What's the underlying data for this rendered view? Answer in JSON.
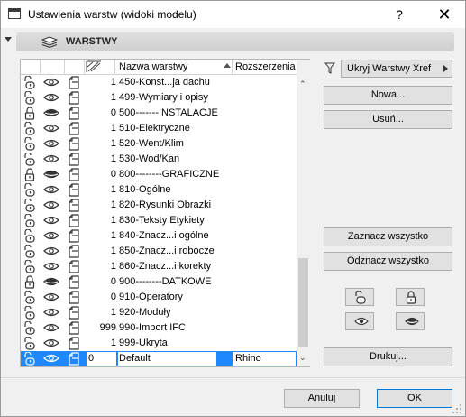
{
  "window": {
    "title": "Ustawienia warstw (widoki modelu)",
    "help_label": "?",
    "close_label": "✕"
  },
  "section": {
    "title": "WARSTWY"
  },
  "table": {
    "headers": {
      "name": "Nazwa warstwy",
      "extension": "Rozszerzenia"
    },
    "rows": [
      {
        "lock": "unlocked",
        "visible": true,
        "pen": "1",
        "name": "450-Konst...ja dachu",
        "ext": ""
      },
      {
        "lock": "unlocked",
        "visible": true,
        "pen": "1",
        "name": "499-Wymiary i opisy",
        "ext": ""
      },
      {
        "lock": "locked",
        "visible": false,
        "pen": "0",
        "name": "500-------INSTALACJE",
        "ext": ""
      },
      {
        "lock": "unlocked",
        "visible": true,
        "pen": "1",
        "name": "510-Elektryczne",
        "ext": ""
      },
      {
        "lock": "unlocked",
        "visible": true,
        "pen": "1",
        "name": "520-Went/Klim",
        "ext": ""
      },
      {
        "lock": "unlocked",
        "visible": true,
        "pen": "1",
        "name": "530-Wod/Kan",
        "ext": ""
      },
      {
        "lock": "locked",
        "visible": false,
        "pen": "0",
        "name": "800--------GRAFICZNE",
        "ext": ""
      },
      {
        "lock": "unlocked",
        "visible": true,
        "pen": "1",
        "name": "810-Ogólne",
        "ext": ""
      },
      {
        "lock": "unlocked",
        "visible": true,
        "pen": "1",
        "name": "820-Rysunki Obrazki",
        "ext": ""
      },
      {
        "lock": "unlocked",
        "visible": true,
        "pen": "1",
        "name": "830-Teksty Etykiety",
        "ext": ""
      },
      {
        "lock": "unlocked",
        "visible": true,
        "pen": "1",
        "name": "840-Znacz...i ogólne",
        "ext": ""
      },
      {
        "lock": "unlocked",
        "visible": true,
        "pen": "1",
        "name": "850-Znacz...i robocze",
        "ext": ""
      },
      {
        "lock": "unlocked",
        "visible": true,
        "pen": "1",
        "name": "860-Znacz...i korekty",
        "ext": ""
      },
      {
        "lock": "locked",
        "visible": false,
        "pen": "0",
        "name": "900--------DATKOWE",
        "ext": ""
      },
      {
        "lock": "unlocked",
        "visible": true,
        "pen": "0",
        "name": "910-Operatory",
        "ext": ""
      },
      {
        "lock": "unlocked",
        "visible": true,
        "pen": "1",
        "name": "920-Moduły",
        "ext": ""
      },
      {
        "lock": "unlocked",
        "visible": true,
        "pen": "999",
        "name": "990-Import IFC",
        "ext": ""
      },
      {
        "lock": "unlocked",
        "visible": true,
        "pen": "1",
        "name": "999-Ukryta",
        "ext": ""
      },
      {
        "lock": "unlocked",
        "visible": true,
        "pen": "0",
        "name": "Default",
        "ext": "Rhino",
        "selected": true
      }
    ]
  },
  "right_panel": {
    "filter_dropdown": "Ukryj Warstwy Xref",
    "new_button": "Nowa...",
    "delete_button": "Usuń...",
    "select_all_button": "Zaznacz wszystko",
    "deselect_all_button": "Odznacz wszystko",
    "print_button": "Drukuj..."
  },
  "footer": {
    "cancel_button": "Anuluj",
    "ok_button": "OK"
  },
  "colors": {
    "selection": "#1e88ff",
    "ok_border": "#0078d7"
  }
}
